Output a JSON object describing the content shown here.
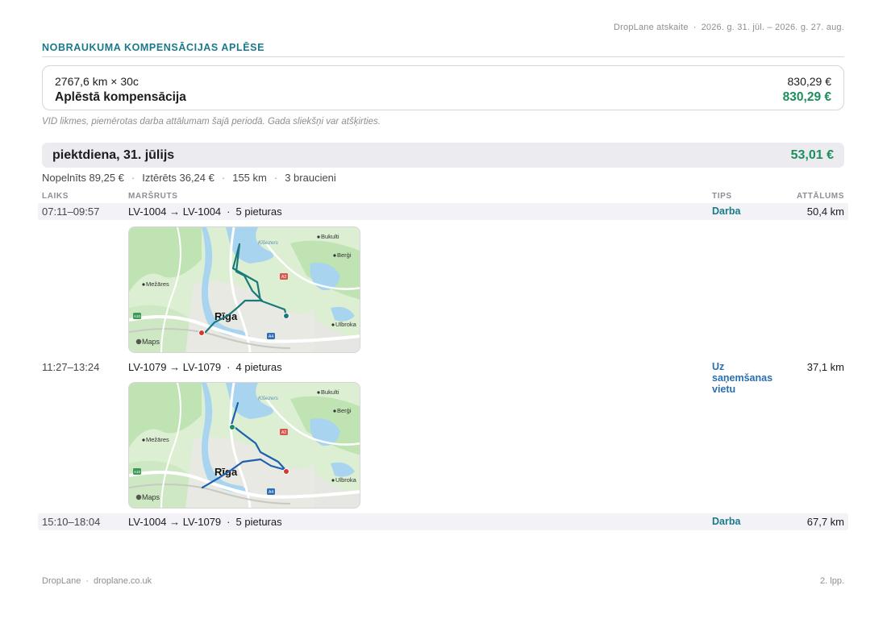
{
  "header": {
    "report_name": "DropLane atskaite",
    "period": "2026. g. 31. jūl. – 2026. g. 27. aug."
  },
  "section": {
    "title": "NOBRAUKUMA KOMPENSĀCIJAS APLĒSE"
  },
  "summary": {
    "formula": "2767,6 km × 30c",
    "formula_amount": "830,29 €",
    "label": "Aplēstā kompensācija",
    "amount": "830,29 €"
  },
  "note": "VID likmes, piemērotas darba attālumam šajā periodā. Gada sliekšņi var atšķirties.",
  "day": {
    "title": "piektdiena, 31. jūlijs",
    "amount": "53,01 €",
    "earned": "Nopelnīts 89,25 €",
    "spent": "Iztērēts 36,24 €",
    "distance": "155 km",
    "trips_count": "3 braucieni"
  },
  "columns": {
    "time": "LAIKS",
    "route": "MARŠRUTS",
    "type": "TIPS",
    "distance": "ATTĀLUMS"
  },
  "trips": [
    {
      "time": "07:11–09:57",
      "route": "LV-1004 → LV-1004",
      "stops": "5 pieturas",
      "type": "Darba",
      "distance": "50,4 km",
      "route_color": "#1a7a7a"
    },
    {
      "time": "11:27–13:24",
      "route": "LV-1079 → LV-1079",
      "stops": "4 pieturas",
      "type": "Uz saņemšanas vietu",
      "distance": "37,1 km",
      "route_color": "#1d5fb0"
    },
    {
      "time": "15:10–18:04",
      "route": "LV-1004 → LV-1079",
      "stops": "5 pieturas",
      "type": "Darba",
      "distance": "67,7 km",
      "route_color": "#1a7a7a"
    }
  ],
  "map_labels": {
    "city": "Rīga",
    "place_1": "Bukulti",
    "place_2": "Berģi",
    "place_3": "Mežāres",
    "place_4": "Ulbroka",
    "place_5": "Ķīšezers",
    "road_1": "A2",
    "road_2": "A4",
    "road_3": "A10",
    "provider": "Maps"
  },
  "footer": {
    "brand": "DropLane",
    "site": "droplane.co.uk",
    "page": "2. lpp."
  }
}
